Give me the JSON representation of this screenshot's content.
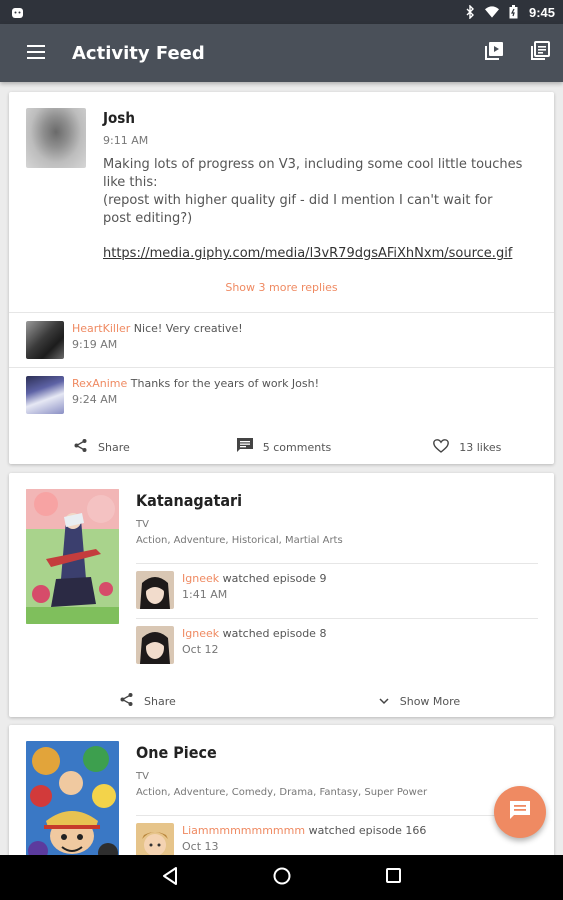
{
  "status_bar": {
    "time": "9:45"
  },
  "toolbar": {
    "title": "Activity Feed"
  },
  "post": {
    "author": "Josh",
    "time": "9:11 AM",
    "text_line1": "Making lots of progress on V3, including some cool little touches like this:",
    "text_line2": "(repost with higher quality gif - did I mention I can't wait for post editing?)",
    "link": "https://media.giphy.com/media/l3vR79dgsAFiXhNxm/source.gif",
    "show_more_replies": "Show 3 more replies",
    "replies": [
      {
        "name": "HeartKiller",
        "text": "Nice! Very creative!",
        "time": "9:19 AM"
      },
      {
        "name": "RexAnime",
        "text": "Thanks for the years of work Josh!",
        "time": "9:24 AM"
      }
    ],
    "actions": {
      "share": "Share",
      "comments": "5 comments",
      "likes": "13 likes"
    }
  },
  "anime_cards": [
    {
      "title": "Katanagatari",
      "type": "TV",
      "genres": "Action, Adventure, Historical, Martial Arts",
      "episodes": [
        {
          "user": "Igneek",
          "action": "watched episode 9",
          "time": "1:41 AM"
        },
        {
          "user": "Igneek",
          "action": "watched episode 8",
          "time": "Oct 12"
        }
      ],
      "actions": {
        "share": "Share",
        "show_more": "Show More"
      }
    },
    {
      "title": "One Piece",
      "type": "TV",
      "genres": "Action, Adventure, Comedy, Drama, Fantasy, Super Power",
      "episodes": [
        {
          "user": "Liammmmmmmmmm",
          "action": "watched episode 166",
          "time": "Oct 13"
        }
      ]
    }
  ],
  "colors": {
    "accent": "#ef8a62",
    "toolbar": "#4a5059",
    "status_bar": "#2f333b",
    "background": "#ececec"
  },
  "icons": {
    "status_left": "android-notification-icon",
    "status_right": [
      "bluetooth-icon",
      "wifi-icon",
      "battery-icon"
    ],
    "toolbar_left": "menu-icon",
    "toolbar_right": [
      "video-library-icon",
      "library-books-icon"
    ],
    "fab": "chat-icon",
    "nav": [
      "back-icon",
      "home-icon",
      "recents-icon"
    ]
  }
}
